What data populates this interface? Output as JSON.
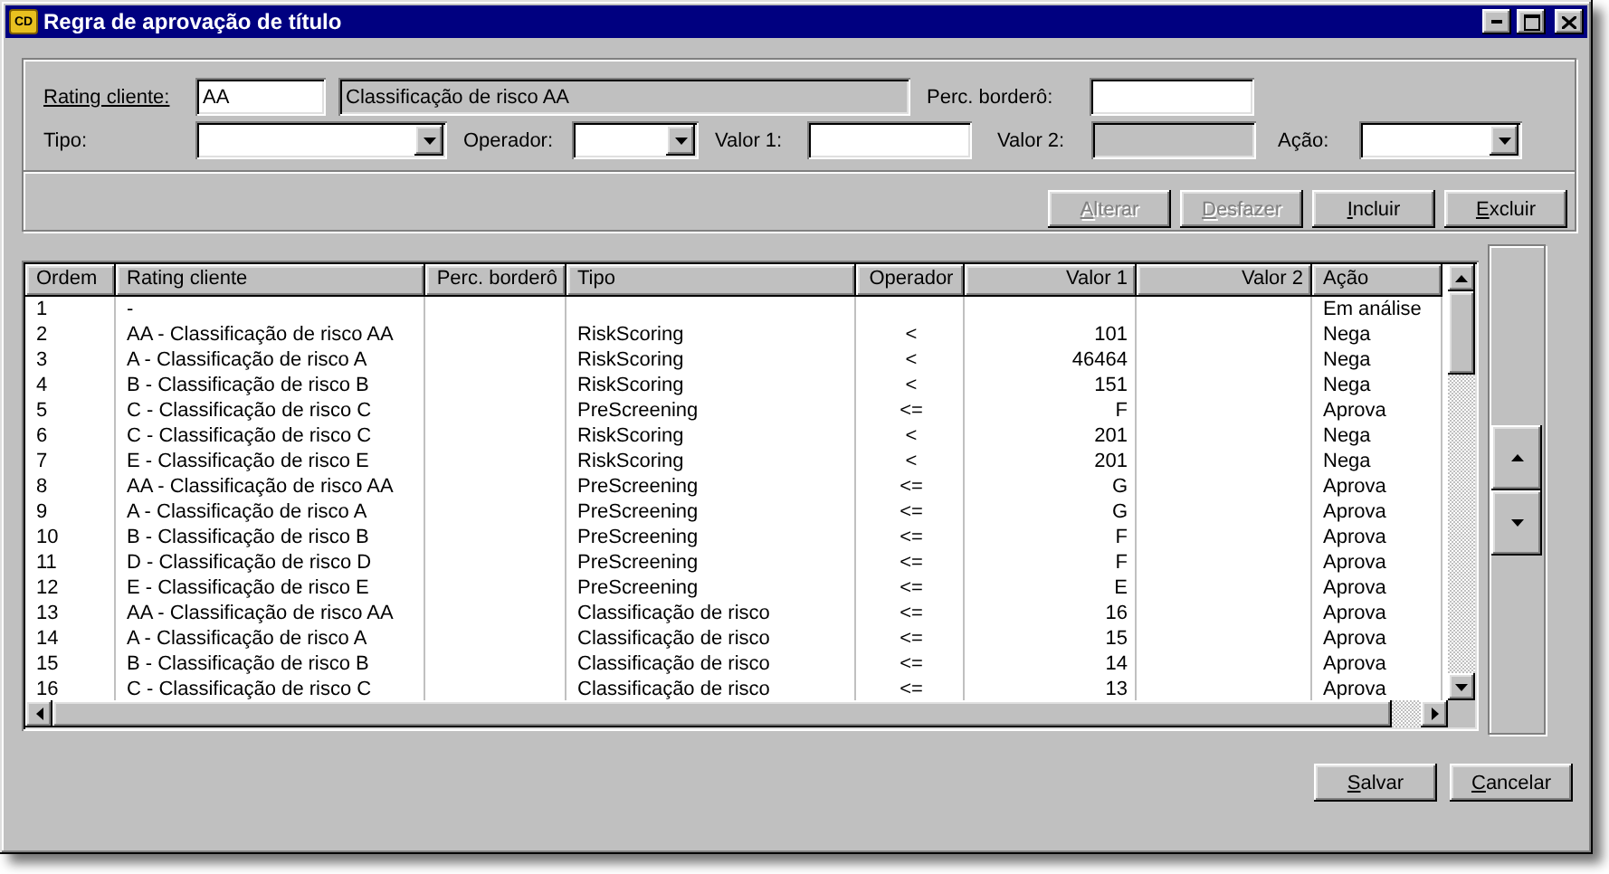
{
  "window": {
    "icon_label": "CD",
    "title": "Regra de aprovação de título"
  },
  "form": {
    "rating_cliente": {
      "label": "Rating cliente:",
      "value": "AA",
      "description": "Classificação de risco AA"
    },
    "perc_bordero": {
      "label": "Perc. borderô:"
    },
    "tipo": {
      "label": "Tipo:"
    },
    "operador": {
      "label": "Operador:"
    },
    "valor_1": {
      "label": "Valor 1:"
    },
    "valor_2": {
      "label": "Valor 2:",
      "disabled": true
    },
    "acao": {
      "label": "Ação:"
    }
  },
  "edit_buttons": [
    {
      "label": "Alterar",
      "disabled": true
    },
    {
      "label": "Desfazer",
      "disabled": true
    },
    {
      "label": "Incluir",
      "disabled": false
    },
    {
      "label": "Excluir",
      "disabled": false
    }
  ],
  "table": {
    "columns": [
      "Ordem",
      "Rating cliente",
      "Perc. borderô",
      "Tipo",
      "Operador",
      "Valor 1",
      "Valor 2",
      "Ação"
    ],
    "rows": [
      [
        "1",
        "-",
        null,
        null,
        null,
        null,
        null,
        "Em análise"
      ],
      [
        "2",
        "AA - Classificação de risco AA",
        null,
        "RiskScoring",
        "<",
        "101",
        null,
        "Nega"
      ],
      [
        "3",
        "A - Classificação de risco A",
        null,
        "RiskScoring",
        "<",
        "46464",
        null,
        "Nega"
      ],
      [
        "4",
        "B - Classificação de risco B",
        null,
        "RiskScoring",
        "<",
        "151",
        null,
        "Nega"
      ],
      [
        "5",
        "C - Classificação de risco C",
        null,
        "PreScreening",
        "<=",
        "F",
        null,
        "Aprova"
      ],
      [
        "6",
        "C - Classificação de risco C",
        null,
        "RiskScoring",
        "<",
        "201",
        null,
        "Nega"
      ],
      [
        "7",
        "E - Classificação de risco E",
        null,
        "RiskScoring",
        "<",
        "201",
        null,
        "Nega"
      ],
      [
        "8",
        "AA - Classificação de risco AA",
        null,
        "PreScreening",
        "<=",
        "G",
        null,
        "Aprova"
      ],
      [
        "9",
        "A - Classificação de risco A",
        null,
        "PreScreening",
        "<=",
        "G",
        null,
        "Aprova"
      ],
      [
        "10",
        "B - Classificação de risco B",
        null,
        "PreScreening",
        "<=",
        "F",
        null,
        "Aprova"
      ],
      [
        "11",
        "D - Classificação de risco D",
        null,
        "PreScreening",
        "<=",
        "F",
        null,
        "Aprova"
      ],
      [
        "12",
        "E - Classificação de risco E",
        null,
        "PreScreening",
        "<=",
        "E",
        null,
        "Aprova"
      ],
      [
        "13",
        "AA - Classificação de risco AA",
        null,
        "Classificação de risco",
        "<=",
        "16",
        null,
        "Aprova"
      ],
      [
        "14",
        "A - Classificação de risco A",
        null,
        "Classificação de risco",
        "<=",
        "15",
        null,
        "Aprova"
      ],
      [
        "15",
        "B - Classificação de risco B",
        null,
        "Classificação de risco",
        "<=",
        "14",
        null,
        "Aprova"
      ],
      [
        "16",
        "C - Classificação de risco C",
        null,
        "Classificação de risco",
        "<=",
        "13",
        null,
        "Aprova"
      ]
    ]
  },
  "footer_buttons": [
    {
      "label": "Salvar",
      "disabled": false
    },
    {
      "label": "Cancelar",
      "disabled": false
    }
  ]
}
